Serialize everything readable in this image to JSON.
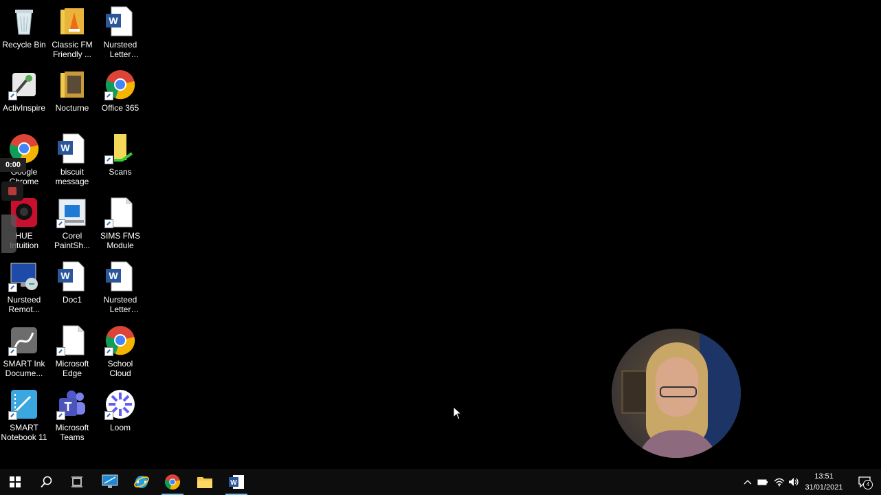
{
  "desktop": {
    "icons": [
      {
        "label": "Recycle Bin",
        "icon": "recycle-bin-icon"
      },
      {
        "label": "Classic FM Friendly ...",
        "icon": "folder-icon"
      },
      {
        "label": "Nursteed Letter Head...",
        "icon": "word-document-icon"
      },
      {
        "label": "ActivInspire",
        "icon": "activinspire-icon"
      },
      {
        "label": "Nocturne",
        "icon": "folder-icon"
      },
      {
        "label": "Office 365",
        "icon": "chrome-icon"
      },
      {
        "label": "Google Chrome",
        "icon": "chrome-icon"
      },
      {
        "label": "biscuit message",
        "icon": "word-document-icon"
      },
      {
        "label": "Scans",
        "icon": "folder-icon"
      },
      {
        "label": "HUE Intuition",
        "icon": "camera-icon"
      },
      {
        "label": "Corel PaintSh...",
        "icon": "corel-icon"
      },
      {
        "label": "SIMS FMS Module",
        "icon": "blank-file-icon"
      },
      {
        "label": "Nursteed Remot...",
        "icon": "remote-desktop-icon"
      },
      {
        "label": "Doc1",
        "icon": "word-document-icon"
      },
      {
        "label": "Nursteed Letter Head...",
        "icon": "word-document-icon"
      },
      {
        "label": "SMART Ink Docume...",
        "icon": "smart-ink-icon"
      },
      {
        "label": "Microsoft Edge",
        "icon": "blank-file-icon"
      },
      {
        "label": "School Cloud",
        "icon": "chrome-icon"
      },
      {
        "label": "SMART Notebook 11",
        "icon": "smart-notebook-icon"
      },
      {
        "label": "Microsoft Teams",
        "icon": "teams-icon"
      },
      {
        "label": "Loom",
        "icon": "loom-icon"
      }
    ]
  },
  "recorder": {
    "timer": "0:00"
  },
  "taskbar": {
    "buttons": [
      "start-icon",
      "search-icon",
      "task-view-icon",
      "remote-desktop-icon",
      "internet-explorer-icon",
      "chrome-icon",
      "file-explorer-icon",
      "word-icon"
    ],
    "clock_time": "13:51",
    "clock_date": "31/01/2021",
    "notification_count": "4"
  },
  "colors": {
    "accent": "#76b9ed",
    "word_blue": "#2b579a",
    "folder_yellow": "#f3c94a"
  }
}
